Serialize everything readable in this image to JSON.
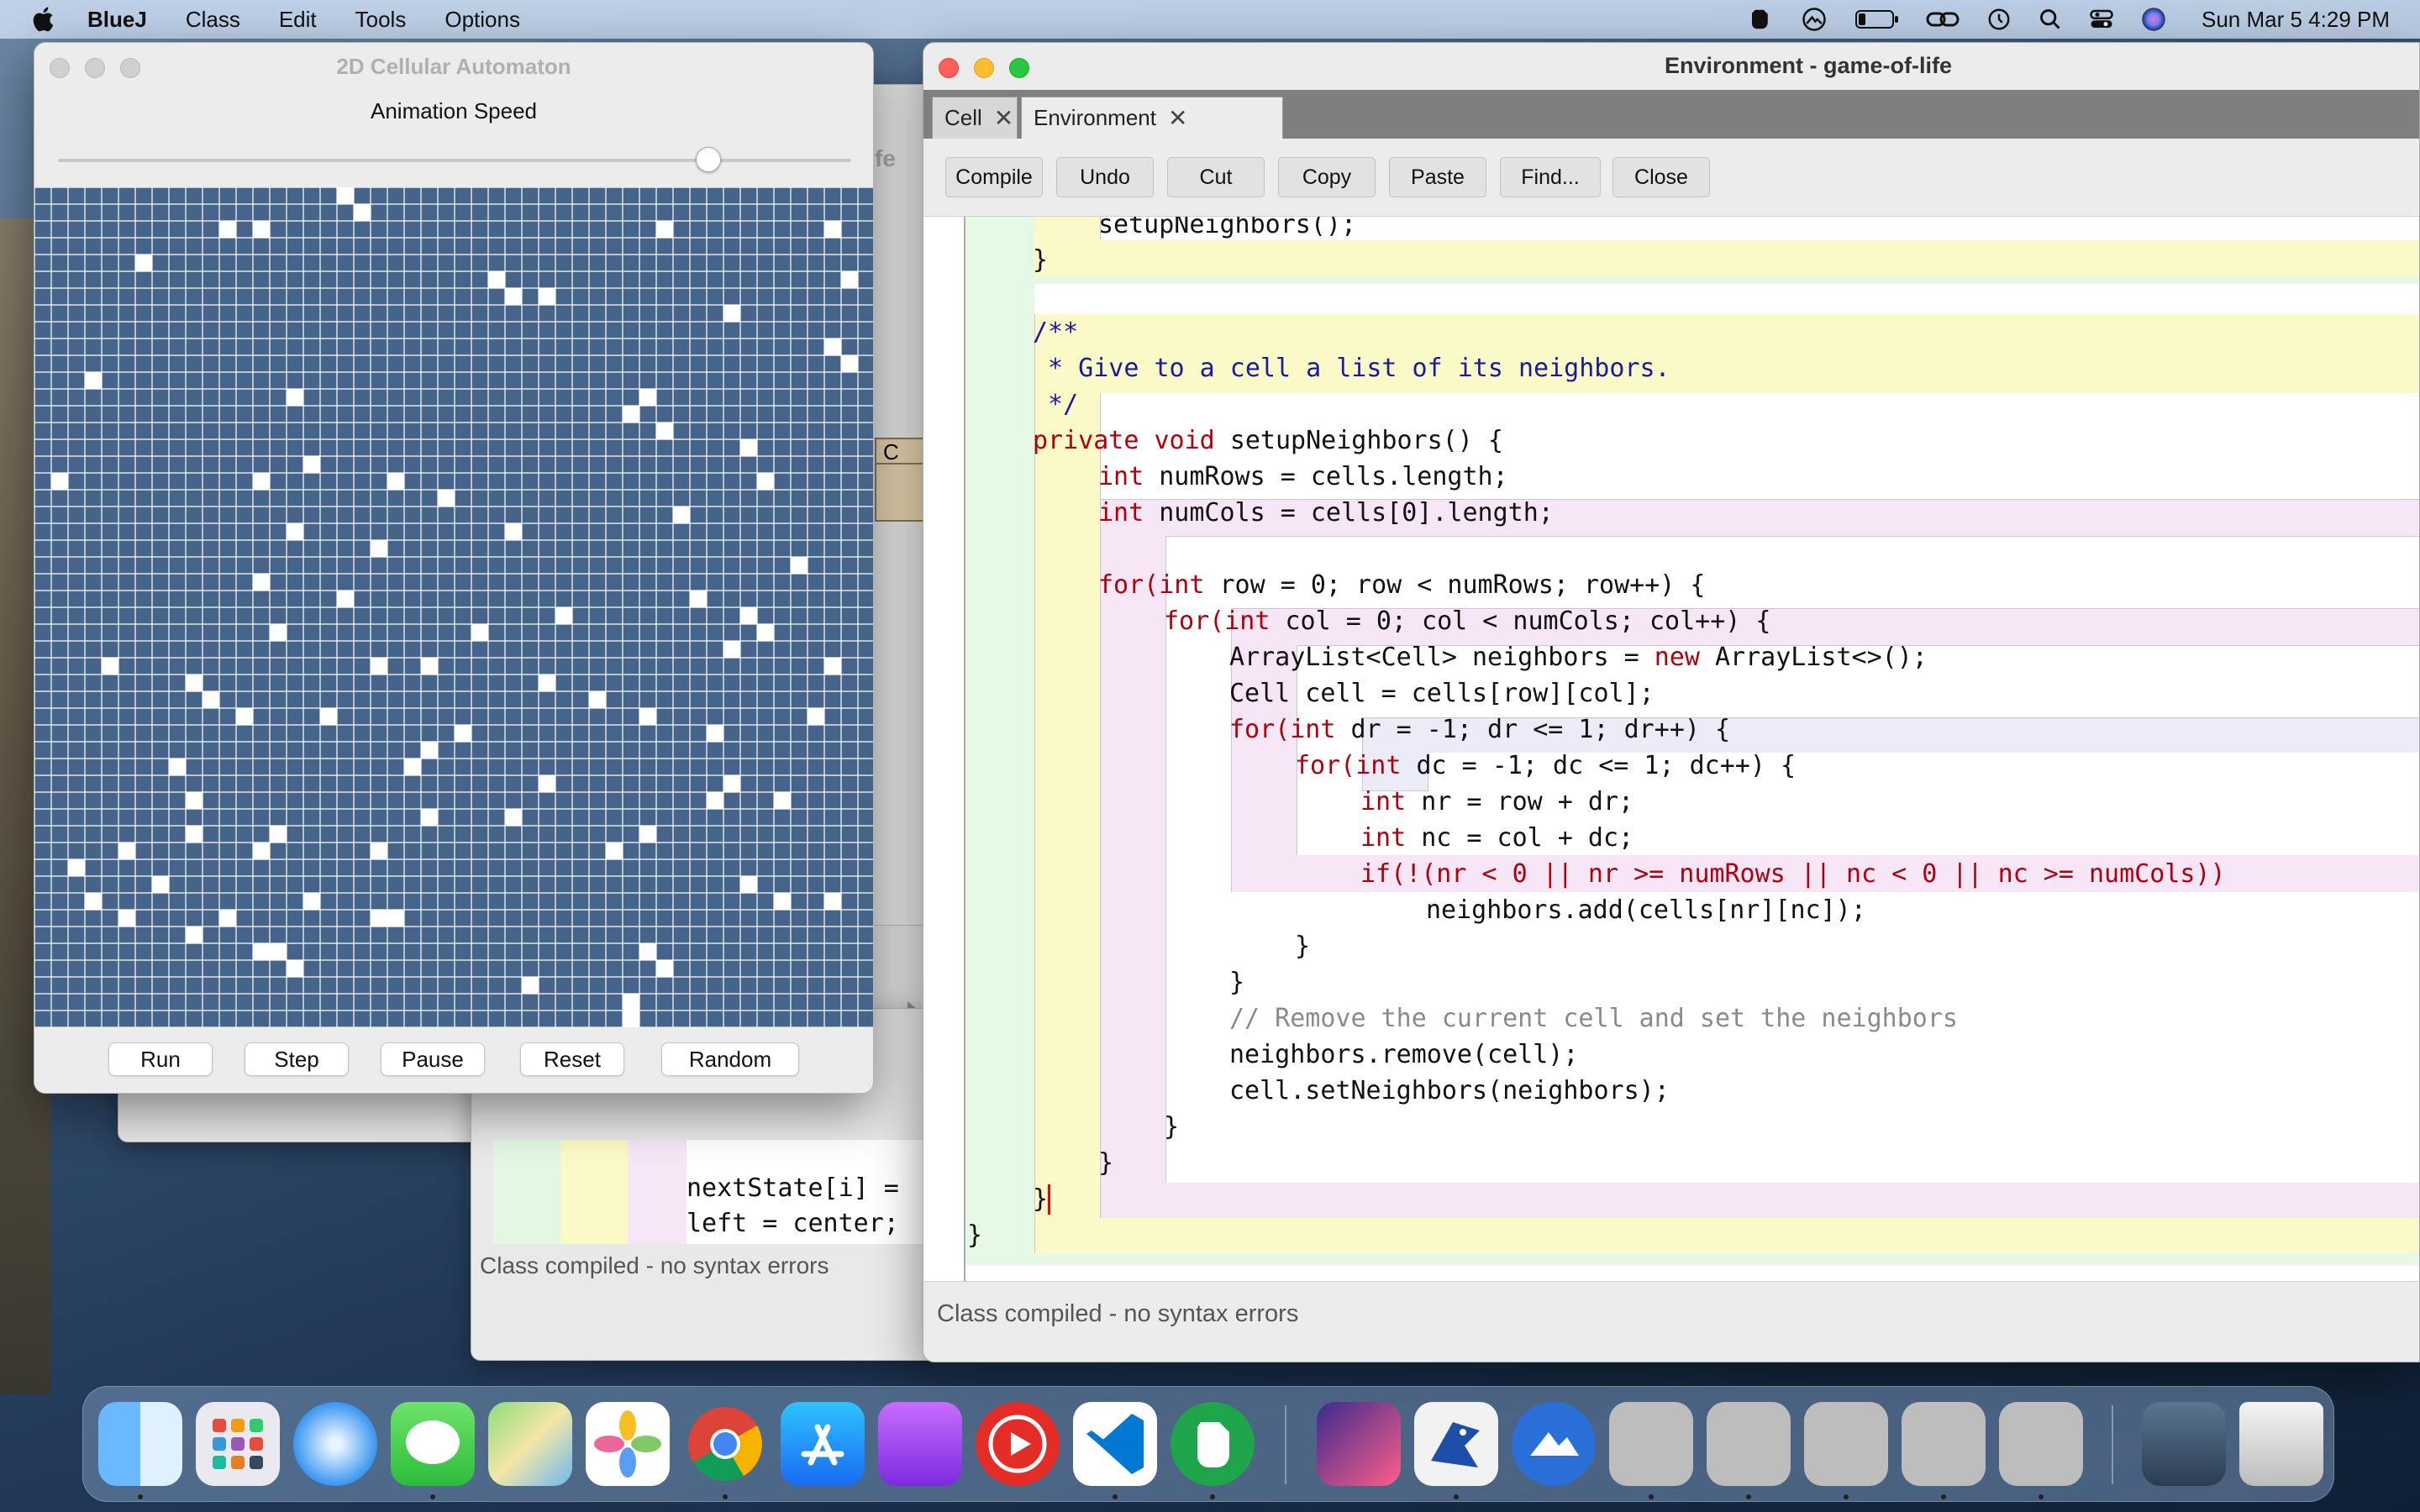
{
  "menubar": {
    "app_name": "BlueJ",
    "menus": [
      "Class",
      "Edit",
      "Tools",
      "Options"
    ],
    "clock": "Sun Mar 5  4:29 PM"
  },
  "background": {
    "status": "Class compiled - no syntax errors",
    "code_line_1": "nextState[i] =",
    "code_line_2": "left = center;",
    "partial_title": "fe",
    "partial_class": "C"
  },
  "automaton": {
    "title": "2D Cellular Automaton",
    "speed_label": "Animation Speed",
    "speed_value": 0.82,
    "buttons": [
      "Run",
      "Step",
      "Pause",
      "Reset",
      "Random"
    ],
    "grid_size": 50,
    "live_cells": [
      [
        0,
        18
      ],
      [
        1,
        19
      ],
      [
        2,
        11
      ],
      [
        2,
        13
      ],
      [
        2,
        37
      ],
      [
        2,
        47
      ],
      [
        4,
        6
      ],
      [
        5,
        27
      ],
      [
        5,
        48
      ],
      [
        6,
        28
      ],
      [
        6,
        30
      ],
      [
        7,
        41
      ],
      [
        9,
        47
      ],
      [
        10,
        48
      ],
      [
        11,
        3
      ],
      [
        12,
        15
      ],
      [
        12,
        36
      ],
      [
        13,
        35
      ],
      [
        14,
        37
      ],
      [
        15,
        42
      ],
      [
        16,
        16
      ],
      [
        17,
        1
      ],
      [
        17,
        13
      ],
      [
        17,
        21
      ],
      [
        17,
        43
      ],
      [
        18,
        24
      ],
      [
        19,
        38
      ],
      [
        20,
        15
      ],
      [
        20,
        28
      ],
      [
        21,
        20
      ],
      [
        23,
        13
      ],
      [
        22,
        45
      ],
      [
        24,
        18
      ],
      [
        24,
        39
      ],
      [
        25,
        31
      ],
      [
        25,
        42
      ],
      [
        26,
        14
      ],
      [
        26,
        26
      ],
      [
        26,
        43
      ],
      [
        27,
        41
      ],
      [
        28,
        4
      ],
      [
        28,
        20
      ],
      [
        28,
        23
      ],
      [
        28,
        47
      ],
      [
        29,
        9
      ],
      [
        29,
        30
      ],
      [
        30,
        10
      ],
      [
        30,
        33
      ],
      [
        31,
        12
      ],
      [
        31,
        17
      ],
      [
        31,
        36
      ],
      [
        31,
        46
      ],
      [
        32,
        25
      ],
      [
        32,
        40
      ],
      [
        33,
        23
      ],
      [
        34,
        8
      ],
      [
        34,
        22
      ],
      [
        35,
        30
      ],
      [
        35,
        41
      ],
      [
        36,
        9
      ],
      [
        36,
        40
      ],
      [
        36,
        44
      ],
      [
        37,
        23
      ],
      [
        37,
        28
      ],
      [
        38,
        9
      ],
      [
        38,
        14
      ],
      [
        38,
        36
      ],
      [
        39,
        5
      ],
      [
        39,
        13
      ],
      [
        39,
        20
      ],
      [
        39,
        34
      ],
      [
        40,
        2
      ],
      [
        41,
        7
      ],
      [
        41,
        42
      ],
      [
        42,
        3
      ],
      [
        42,
        16
      ],
      [
        42,
        44
      ],
      [
        42,
        47
      ],
      [
        43,
        5
      ],
      [
        43,
        11
      ],
      [
        43,
        20
      ],
      [
        43,
        21
      ],
      [
        44,
        9
      ],
      [
        45,
        13
      ],
      [
        45,
        14
      ],
      [
        45,
        36
      ],
      [
        46,
        15
      ],
      [
        46,
        37
      ],
      [
        47,
        29
      ],
      [
        48,
        35
      ],
      [
        49,
        35
      ]
    ]
  },
  "editor": {
    "title": "Environment - game-of-life",
    "tabs": [
      {
        "label": "Cell",
        "close": "✕"
      },
      {
        "label": "Environment",
        "close": "✕"
      }
    ],
    "toolbar": [
      "Compile",
      "Undo",
      "Cut",
      "Copy",
      "Paste",
      "Find...",
      "Close"
    ],
    "status": "Class compiled - no syntax errors",
    "code_lines": [
      "setupNeighbors();",
      "}",
      "/**",
      " * Give to a cell a list of its neighbors.",
      " */",
      "setupNeighbors() {",
      "numRows = cells.length;",
      "numCols = cells[0].length;",
      "for(",
      "row = 0; row < numRows; row++) {",
      "for(",
      "col = 0; col < numCols; col++) {",
      "ArrayList<Cell> neighbors = ",
      "ArrayList<>();",
      "Cell cell = cells[row][col];",
      "for(",
      "dr = -1; dr <= 1; dr++) {",
      "for(",
      "dc = -1; dc <= 1; dc++) {",
      "nr = row + dr;",
      "nc = col + dc;",
      "if(!(nr < 0 || nr >= numRows || nc < 0 || nc >= numCols))",
      "neighbors.add(cells[nr][nc]);",
      "}",
      "}",
      "// Remove the current cell and set the neighbors",
      "neighbors.remove(cell);",
      "cell.setNeighbors(neighbors);",
      "}",
      "}",
      "}",
      "}"
    ],
    "keywords": {
      "private": "private",
      "void": "void",
      "int": "int",
      "new": "new"
    }
  },
  "dock": {
    "apps": [
      "finder-icon",
      "launchpad-icon",
      "safari-icon",
      "messages-icon",
      "maps-icon",
      "photos-icon",
      "chrome-icon",
      "app-store-icon",
      "podcasts-icon",
      "youtube-icon",
      "vscode-icon",
      "evernote-icon",
      "shortcuts-icon",
      "bluej-icon",
      "hiking-icon",
      "bluej-doc-icon",
      "bluej-doc-icon",
      "bluej-doc-icon",
      "bluej-doc-icon",
      "bluej-doc-icon",
      "screenshot-icon",
      "trash-icon"
    ]
  }
}
